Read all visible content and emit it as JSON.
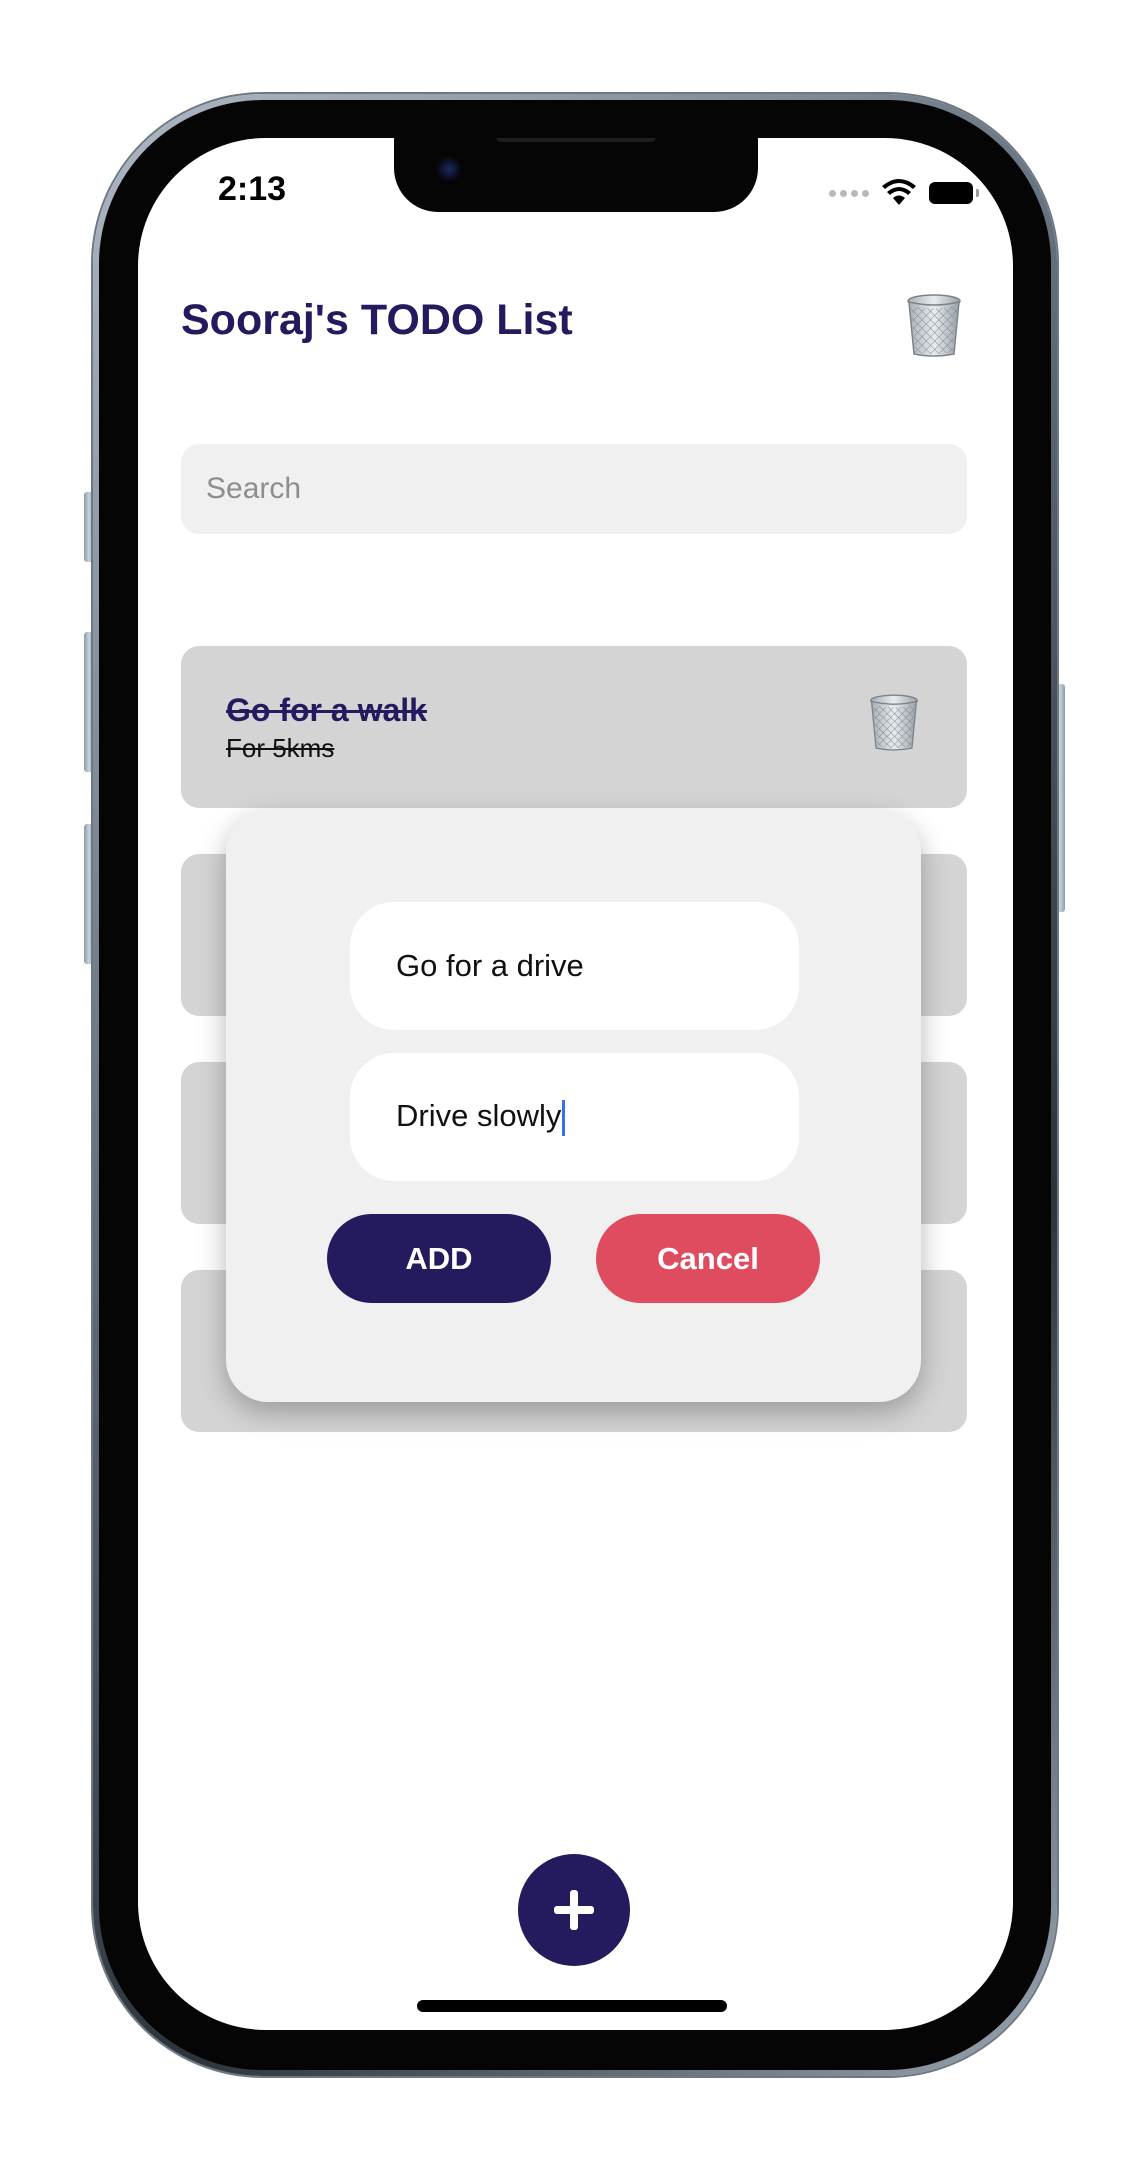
{
  "status_bar": {
    "time": "2:13"
  },
  "app": {
    "title": "Sooraj's TODO List"
  },
  "search": {
    "placeholder": "Search"
  },
  "todos": [
    {
      "title": "Go for a walk",
      "description": "For 5kms",
      "completed": true
    }
  ],
  "dialog": {
    "title_value": "Go for a drive",
    "description_value": "Drive slowly",
    "add_label": "ADD",
    "cancel_label": "Cancel"
  },
  "fab": {
    "icon": "plus-icon"
  },
  "colors": {
    "primary": "#241a5e",
    "cancel": "#e04c5f",
    "card": "#d4d4d4",
    "dialog": "#f0f0f0"
  }
}
